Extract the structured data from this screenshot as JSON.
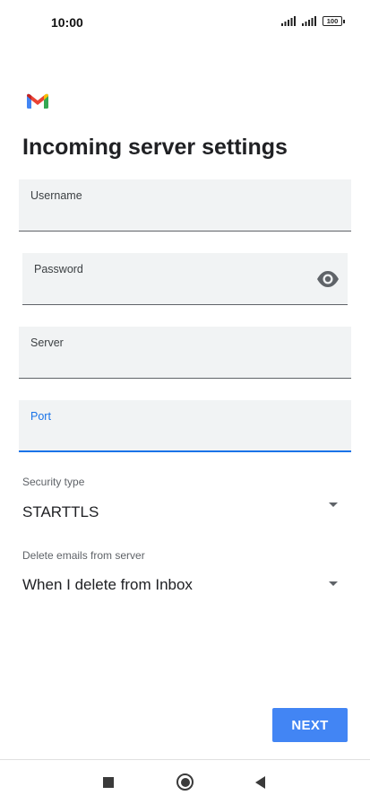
{
  "status_bar": {
    "time": "10:00",
    "battery": "100"
  },
  "page": {
    "title": "Incoming server settings"
  },
  "fields": {
    "username": {
      "label": "Username",
      "value": ""
    },
    "password": {
      "label": "Password",
      "value": ""
    },
    "server": {
      "label": "Server",
      "value": ""
    },
    "port": {
      "label": "Port",
      "value": ""
    }
  },
  "security_type": {
    "label": "Security type",
    "value": "STARTTLS"
  },
  "delete_emails": {
    "label": "Delete emails from server",
    "value": "When I delete from Inbox"
  },
  "actions": {
    "next_label": "NEXT"
  },
  "colors": {
    "accent": "#1a73e8",
    "button": "#4285f4"
  }
}
